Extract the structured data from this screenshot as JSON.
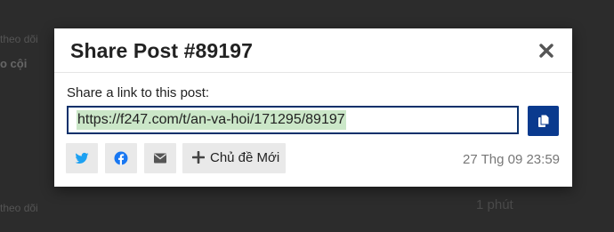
{
  "background": {
    "text_1": "theo dõi",
    "text_2": "o cội",
    "text_3": "theo dõi",
    "text_4": "1 phút"
  },
  "modal": {
    "title": "Share Post #89197",
    "share_label": "Share a link to this post:",
    "url": "https://f247.com/t/an-va-hoi/171295/89197",
    "new_topic_label": "Chủ đề Mới",
    "timestamp": "27 Thg 09 23:59",
    "icons": {
      "close": "close-icon",
      "copy": "copy-icon",
      "twitter": "twitter-icon",
      "facebook": "facebook-icon",
      "email": "envelope-icon",
      "plus": "plus-icon"
    }
  },
  "colors": {
    "overlay": "#2c2c2c",
    "accent": "#0a3a8e",
    "input_border": "#08306b",
    "selection": "#cbe7c8",
    "twitter": "#1da1f2",
    "facebook": "#1877f2",
    "button_bg": "#e9e9e9"
  }
}
